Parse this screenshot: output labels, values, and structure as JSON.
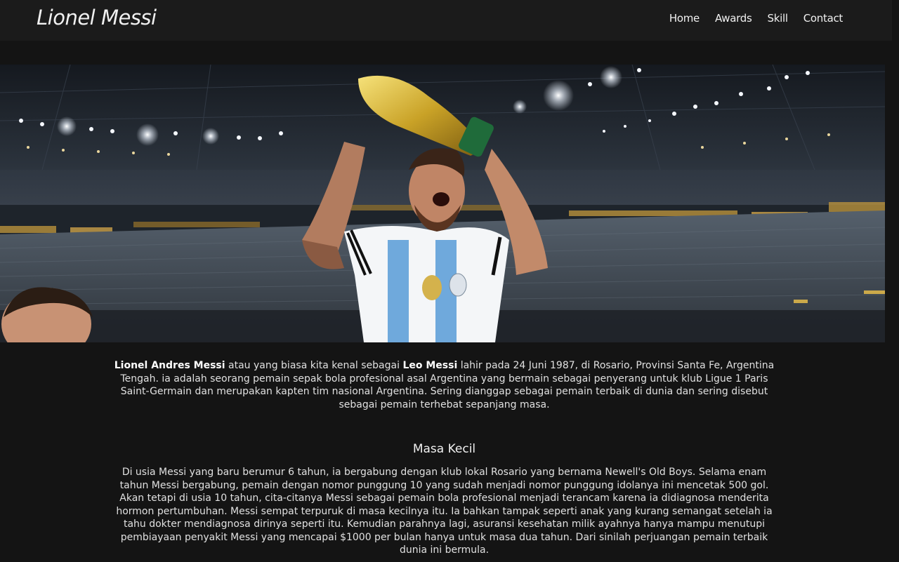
{
  "header": {
    "brand": "Lionel Messi",
    "nav": [
      {
        "label": "Home"
      },
      {
        "label": "Awards"
      },
      {
        "label": "Skill"
      },
      {
        "label": "Contact"
      }
    ]
  },
  "hero": {
    "image_description_icon": "messi-trophy-photo"
  },
  "intro": {
    "name_bold": "Lionel Andres Messi",
    "text_1": " atau yang biasa kita kenal sebagai ",
    "nickname_bold": "Leo Messi",
    "text_2": " lahir pada 24 Juni 1987, di Rosario, Provinsi Santa Fe, Argentina Tengah. ia adalah seorang pemain sepak bola profesional asal Argentina yang bermain sebagai penyerang untuk klub Ligue 1 Paris Saint-Germain dan merupakan kapten tim nasional Argentina. Sering dianggap sebagai pemain terbaik di dunia dan sering disebut sebagai pemain terhebat sepanjang masa."
  },
  "masa_kecil": {
    "title": "Masa Kecil",
    "body": "Di usia Messi yang baru berumur 6 tahun, ia bergabung dengan klub lokal Rosario yang bernama Newell's Old Boys. Selama enam tahun Messi bergabung, pemain dengan nomor punggung 10 yang sudah menjadi nomor punggung idolanya ini mencetak 500 gol. Akan tetapi di usia 10 tahun, cita-citanya Messi sebagai pemain bola profesional menjadi terancam karena ia didiagnosa menderita hormon pertumbuhan. Messi sempat terpuruk di masa kecilnya itu. Ia bahkan tampak seperti anak yang kurang semangat setelah ia tahu dokter mendiagnosa dirinya seperti itu. Kemudian parahnya lagi, asuransi kesehatan milik ayahnya hanya mampu menutupi pembiayaan penyakit Messi yang mencapai $1000 per bulan hanya untuk masa dua tahun. Dari sinilah perjuangan pemain terbaik dunia ini bermula."
  }
}
